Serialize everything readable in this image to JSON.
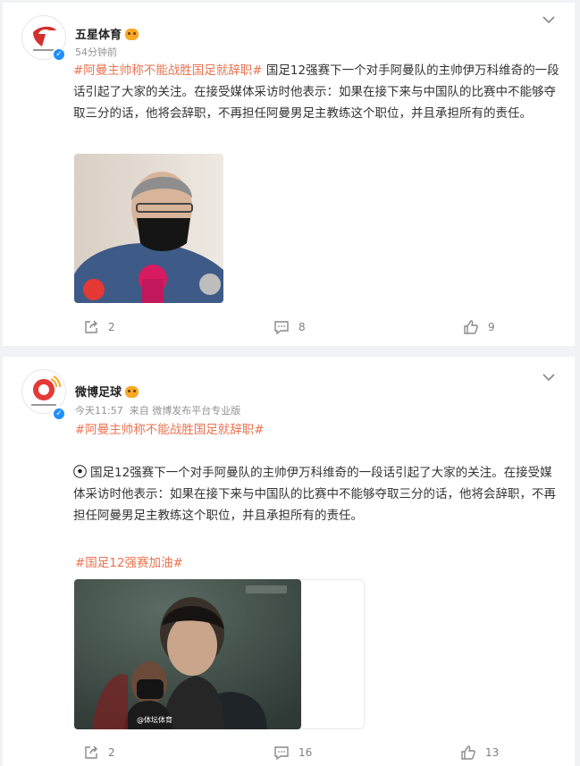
{
  "posts": [
    {
      "username": "五星体育",
      "time": "54分钟前",
      "hashtag": "#阿曼主帅称不能战胜国足就辞职#",
      "text": "国足12强赛下一个对手阿曼队的主帅伊万科维奇的一段话引起了大家的关注。在接受媒体采访时他表示：如果在接下来与中国队的比赛中不能够夺取三分的话，他将会辞职，不再担任阿曼男足主教练这个职位，并且承担所有的责任。",
      "reposts": "2",
      "comments": "8",
      "likes": "9"
    },
    {
      "username": "微博足球",
      "time": "今天11:57",
      "source": "来自 微博发布平台专业版",
      "hashtag": "#阿曼主帅称不能战胜国足就辞职#",
      "text": "国足12强赛下一个对手阿曼队的主帅伊万科维奇的一段话引起了大家的关注。在接受媒体采访时他表示：如果在接下来与中国队的比赛中不能够夺取三分的话，他将会辞职，不再担任阿曼男足主教练这个职位，并且承担所有的责任。",
      "hashtag2": "#国足12强赛加油#",
      "watermark": "@体坛体育",
      "reposts": "2",
      "comments": "16",
      "likes": "13"
    }
  ],
  "colors": {
    "link": "#eb7350",
    "verified": "#1e90ff",
    "background": "#f1f2f5"
  }
}
